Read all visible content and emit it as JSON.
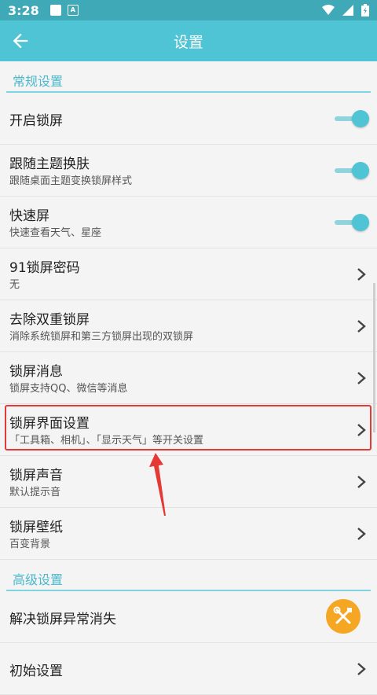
{
  "status_bar": {
    "time": "3:28"
  },
  "app_bar": {
    "title": "设置",
    "back_icon": "arrow-left-icon"
  },
  "sections": {
    "general": "常规设置",
    "advanced": "高级设置"
  },
  "rows": {
    "enable_lock": {
      "title": "开启锁屏",
      "toggle_on": true
    },
    "follow_theme": {
      "title": "跟随主题换肤",
      "subtitle": "跟随桌面主题变换锁屏样式",
      "toggle_on": true
    },
    "quick_screen": {
      "title": "快速屏",
      "subtitle": "快速查看天气、星座",
      "toggle_on": true
    },
    "password": {
      "title": "91锁屏密码",
      "subtitle": "无"
    },
    "remove_double": {
      "title": "去除双重锁屏",
      "subtitle": "消除系统锁屏和第三方锁屏出现的双锁屏"
    },
    "messages": {
      "title": "锁屏消息",
      "subtitle": "锁屏支持QQ、微信等消息"
    },
    "ui_settings": {
      "title": "锁屏界面设置",
      "subtitle": "「工具箱、相机」、「显示天气」等开关设置"
    },
    "sound": {
      "title": "锁屏声音",
      "subtitle": "默认提示音"
    },
    "wallpaper": {
      "title": "锁屏壁纸",
      "subtitle": "百变背景"
    },
    "fix_disappear": {
      "title": "解决锁屏异常消失"
    },
    "initial": {
      "title": "初始设置"
    }
  },
  "colors": {
    "status_bar": "#3fa9b7",
    "app_bar": "#4fc4d4",
    "accent": "#4bb8cc",
    "highlight": "#e53935",
    "fab": "#f5a623"
  }
}
